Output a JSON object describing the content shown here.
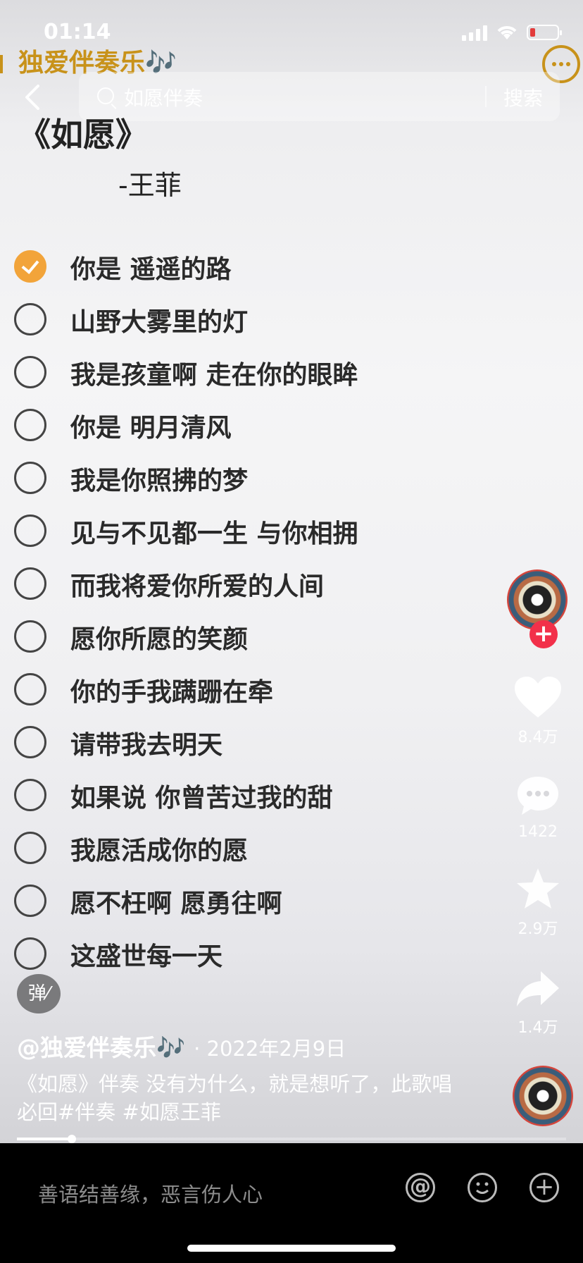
{
  "status_bar": {
    "time": "01:14"
  },
  "header": {
    "account_title": "独爱伴奏乐🎶"
  },
  "search": {
    "query": "如愿伴奏",
    "button": "搜索"
  },
  "song": {
    "title": "《如愿》",
    "singer": "-王菲"
  },
  "lyrics": [
    {
      "text": "你是 遥遥的路",
      "checked": true
    },
    {
      "text": "山野大雾里的灯",
      "checked": false
    },
    {
      "text": "我是孩童啊 走在你的眼眸",
      "checked": false
    },
    {
      "text": "你是 明月清风",
      "checked": false
    },
    {
      "text": "我是你照拂的梦",
      "checked": false
    },
    {
      "text": "见与不见都一生 与你相拥",
      "checked": false
    },
    {
      "text": "而我将爱你所爱的人间",
      "checked": false
    },
    {
      "text": "愿你所愿的笑颜",
      "checked": false
    },
    {
      "text": "你的手我蹒跚在牵",
      "checked": false
    },
    {
      "text": "请带我去明天",
      "checked": false
    },
    {
      "text": "如果说 你曾苦过我的甜",
      "checked": false
    },
    {
      "text": "我愿活成你的愿",
      "checked": false
    },
    {
      "text": "愿不枉啊 愿勇往啊",
      "checked": false
    },
    {
      "text": "这盛世每一天",
      "checked": false
    }
  ],
  "actions": {
    "likes": "8.4万",
    "comments": "1422",
    "favorites": "2.9万",
    "shares": "1.4万"
  },
  "danmu_label": "弹",
  "post": {
    "author": "@独爱伴奏乐🎶",
    "date": "· 2022年2月9日",
    "description": "《如愿》伴奏 没有为什么，就是想听了，此歌唱必回#伴奏 #如愿王菲"
  },
  "progress": 0.1,
  "comment_placeholder": "善语结善缘，恶言伤人心",
  "colors": {
    "accent_gold": "#c8921a",
    "check_orange": "#f2a43a",
    "follow_red": "#f2304a"
  }
}
